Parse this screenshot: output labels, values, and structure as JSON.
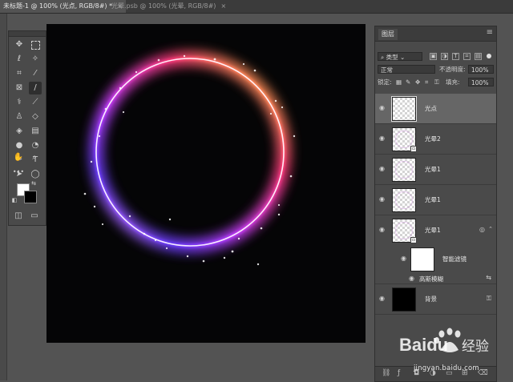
{
  "tabs": [
    {
      "label": "未标题-1 @ 100% (光点, RGB/8#) *",
      "close": "×"
    },
    {
      "label": "光晕.psb @ 100% (光晕, RGB/8#)",
      "close": "×"
    }
  ],
  "toolbox": {
    "tools": [
      "move-tool",
      "marquee-tool",
      "lasso-tool",
      "magic-wand-tool",
      "crop-tool",
      "eyedropper-tool",
      "frame-tool",
      "brush-tool",
      "healing-tool",
      "history-brush-tool",
      "stamp-tool",
      "eraser-tool",
      "paint-bucket-tool",
      "dodge-tool",
      "blur-tool",
      "pen-tool",
      "type-tool",
      "path-select-tool",
      "ellipse-tool",
      "hand-tool",
      "zoom-tool",
      "more-tools"
    ],
    "more": "•••"
  },
  "layers_panel": {
    "tab": "图层",
    "menu": "≡",
    "filter_kind": "类型",
    "blend_mode": "正常",
    "opacity_label": "不透明度:",
    "opacity_value": "100%",
    "lock_label": "锁定:",
    "fill_label": "填充:",
    "fill_value": "100%",
    "layers": [
      {
        "name": "光点",
        "selected": true,
        "thumb": "transparent"
      },
      {
        "name": "光晕2",
        "selected": false,
        "thumb": "smart"
      },
      {
        "name": "光晕1",
        "selected": false,
        "thumb": "transparent"
      },
      {
        "name": "光晕1",
        "selected": false,
        "thumb": "transparent"
      },
      {
        "name": "光晕1",
        "selected": false,
        "thumb": "smart"
      },
      {
        "name": "智能滤镜",
        "selected": false,
        "thumb": "white",
        "sub": true
      },
      {
        "name": "高斯模糊",
        "selected": false,
        "filter": true
      },
      {
        "name": "背景",
        "selected": false,
        "thumb": "black",
        "locked": true
      }
    ],
    "footer": [
      "link-icon",
      "fx-icon",
      "mask-icon",
      "adjustment-icon",
      "group-icon",
      "new-layer-icon",
      "trash-icon"
    ]
  },
  "canvas": {
    "ring_gradient": [
      "#ffd23a",
      "#ff3a7a",
      "#c23cff",
      "#6a3cff",
      "#ff9bf0"
    ],
    "background": "#050506"
  },
  "watermark": {
    "brand": "Baidu",
    "text": "经验",
    "url": "jingyan.baidu.com"
  }
}
